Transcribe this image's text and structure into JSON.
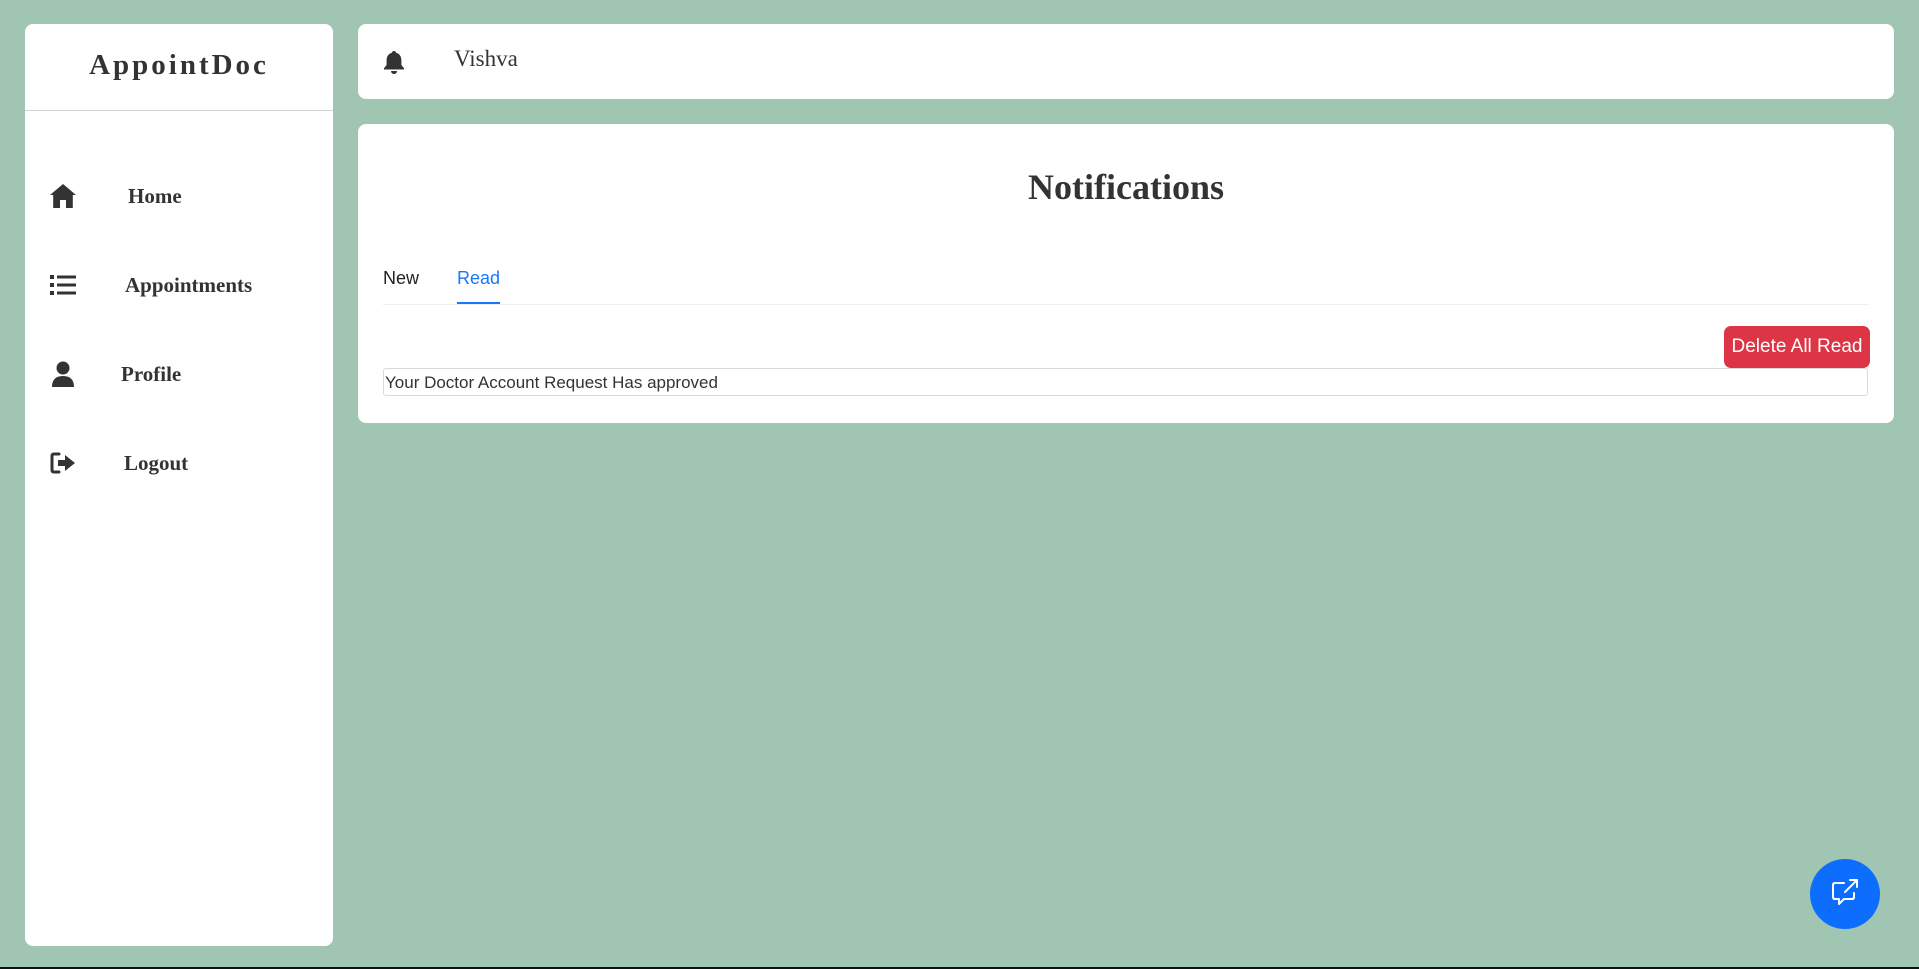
{
  "app": {
    "title": "AppointDoc"
  },
  "sidebar": {
    "items": [
      {
        "label": "Home",
        "icon": "home-icon"
      },
      {
        "label": "Appointments",
        "icon": "list-icon"
      },
      {
        "label": "Profile",
        "icon": "user-icon"
      },
      {
        "label": "Logout",
        "icon": "logout-icon"
      }
    ]
  },
  "header": {
    "icon": "bell-icon",
    "username": "Vishva"
  },
  "main": {
    "title": "Notifications",
    "tabs": [
      {
        "label": "New",
        "active": false
      },
      {
        "label": "Read",
        "active": true
      }
    ],
    "delete_button_label": "Delete All Read",
    "notifications": [
      {
        "text": "Your Doctor Account Request Has approved"
      }
    ]
  },
  "fab": {
    "icon": "external-chat-icon"
  },
  "colors": {
    "background": "#a1c5b3",
    "accent": "#1677ff",
    "danger": "#dc3545",
    "fab": "#0d6efd"
  }
}
